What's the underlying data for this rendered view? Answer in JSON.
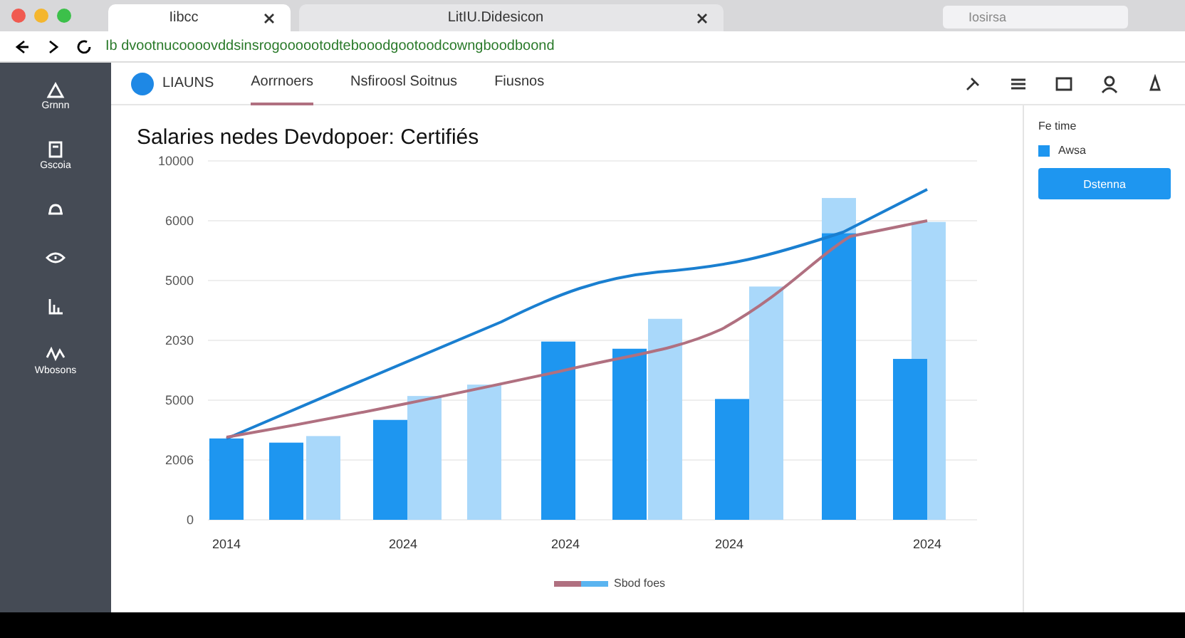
{
  "browser": {
    "tabs": [
      {
        "label": "Iibcc",
        "selected": true
      },
      {
        "label": "LitIU.Didesicon",
        "selected": false
      }
    ],
    "search": {
      "placeholder": "Iosirsa"
    },
    "address": "Ib dvootnucoooovddsinsrogoooootodtebooodgootoodcowngboodboond"
  },
  "sidebar": {
    "items": [
      {
        "kind": "mountain",
        "label": "Grnnn",
        "selected": false
      },
      {
        "kind": "doc",
        "label": "Gscoia",
        "selected": false
      },
      {
        "kind": "bell",
        "selected": false
      },
      {
        "kind": "eye",
        "selected": false
      },
      {
        "kind": "chart",
        "selected": false
      },
      {
        "kind": "wave",
        "label": "Wbosons",
        "selected": false
      }
    ]
  },
  "header": {
    "brand": "LIAUNS",
    "nav": [
      {
        "label": "Aorrnoers",
        "selected": true
      },
      {
        "label": "Nsfiroosl Soitnus",
        "selected": false
      },
      {
        "label": "Fiusnos",
        "selected": false
      }
    ]
  },
  "main": {
    "title": "Salaries nedes Devdopoer: Certifiés",
    "legend": "Sbod foes",
    "y_axis_labels": [
      "10000",
      "6000",
      "5000",
      "2030",
      "5000",
      "2006",
      "0"
    ],
    "x_axis_labels": [
      "2014",
      "2024",
      "2024",
      "2024",
      "2024"
    ]
  },
  "panel": {
    "heading": "Fe time",
    "option": {
      "label": "Awsa",
      "checked": true
    },
    "button": "Dstenna"
  }
}
